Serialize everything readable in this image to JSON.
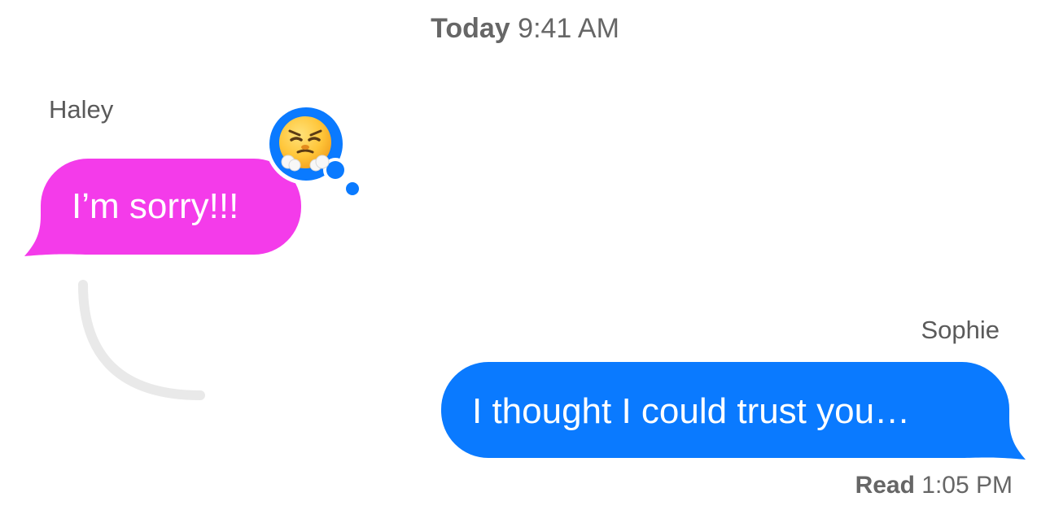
{
  "header": {
    "day": "Today",
    "time": "9:41 AM"
  },
  "messages": [
    {
      "sender": "Haley",
      "text": "I’m sorry!!!",
      "direction": "incoming",
      "bubble_color": "#F43BEA",
      "tapback": {
        "icon": "face-with-steam-from-nose-emoji",
        "badge_color": "#0A7AFF"
      }
    },
    {
      "sender": "Sophie",
      "text": "I thought I could trust you…",
      "direction": "outgoing",
      "bubble_color": "#0A7AFF"
    }
  ],
  "receipt": {
    "label": "Read",
    "time": "1:05 PM"
  },
  "colors": {
    "background": "#FFFFFF",
    "secondary_text": "#666666",
    "swipe_arc": "#E9E9E9"
  }
}
